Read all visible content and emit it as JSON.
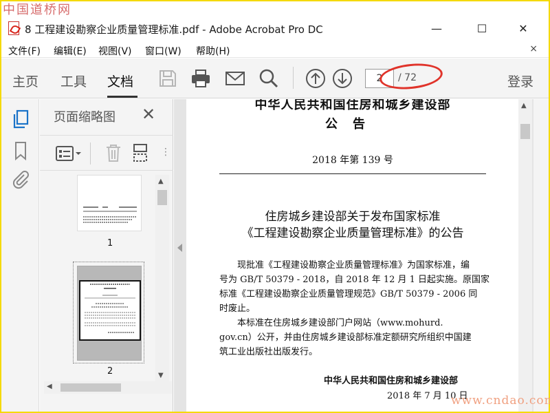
{
  "watermark": {
    "top": "中国道桥网",
    "bottom": "www.cndao.com"
  },
  "window": {
    "title": "8 工程建设勘察企业质量管理标准.pdf - Adobe Acrobat Pro DC",
    "buttons": {
      "minimize": "—",
      "maximize": "☐",
      "close": "✕"
    }
  },
  "menubar": {
    "items": [
      "文件(F)",
      "编辑(E)",
      "视图(V)",
      "窗口(W)",
      "帮助(H)"
    ],
    "close": "×"
  },
  "toolbar": {
    "tabs": [
      "主页",
      "工具",
      "文档"
    ],
    "active_tab": "文档",
    "icons": [
      "save-icon",
      "print-icon",
      "mail-icon",
      "search-icon",
      "page-up-icon",
      "page-down-icon"
    ],
    "current_page": "2",
    "total_pages": "/ 72",
    "login": "登录"
  },
  "thumbnail_panel": {
    "title": "页面缩略图",
    "close": "✕",
    "thumbnails": [
      {
        "label": "1"
      },
      {
        "label": "2",
        "selected": true
      }
    ]
  },
  "document": {
    "issuer": "中华人民共和国住房和城乡建设部",
    "notice_word": "公告",
    "number": "2018 年第 139 号",
    "title_line1": "住房城乡建设部关于发布国家标准",
    "title_line2": "《工程建设勘察企业质量管理标准》的公告",
    "body": [
      "现批准《工程建设勘察企业质量管理标准》为国家标准，编",
      "号为 GB/T 50379 - 2018，自 2018 年 12 月 1 日起实施。原国家",
      "标准《工程建设勘察企业质量管理规范》GB/T 50379 - 2006 同",
      "时废止。",
      "本标准在住房城乡建设部门户网站（www.mohurd.",
      "gov.cn）公开，并由住房城乡建设部标准定额研究所组织中国建",
      "筑工业出版社出版发行。"
    ],
    "signature": "中华人民共和国住房和城乡建设部",
    "date": "2018 年 7 月 10 日"
  },
  "colors": {
    "annotation": "#e0332a",
    "frame": "#f5d900"
  }
}
